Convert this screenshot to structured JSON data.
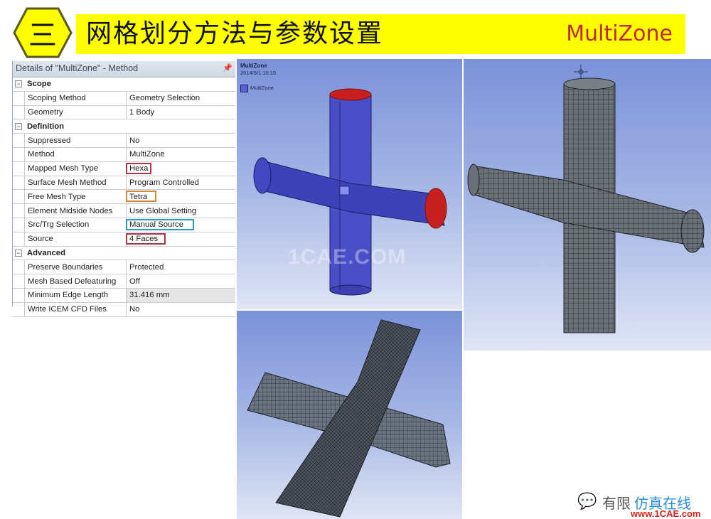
{
  "banner": {
    "section_numeral": "三",
    "title": "网格划分方法与参数设置",
    "tag": "MultiZone",
    "colors": {
      "banner_bg": "#ffff00",
      "tag_text": "#c0281e",
      "hex_fill": "#ffff00",
      "hex_border": "#5a5a1e"
    }
  },
  "details_panel": {
    "title": "Details of \"MultiZone\" - Method",
    "pin_icon": "pin-icon",
    "categories": [
      {
        "label": "Scope",
        "rows": [
          {
            "name": "Scoping Method",
            "value": "Geometry Selection"
          },
          {
            "name": "Geometry",
            "value": "1 Body"
          }
        ]
      },
      {
        "label": "Definition",
        "rows": [
          {
            "name": "Suppressed",
            "value": "No"
          },
          {
            "name": "Method",
            "value": "MultiZone"
          },
          {
            "name": "Mapped Mesh Type",
            "value": "Hexa",
            "highlight": "#b0324a"
          },
          {
            "name": "Surface Mesh Method",
            "value": "Program Controlled"
          },
          {
            "name": "Free Mesh Type",
            "value": "Tetra",
            "highlight": "#d58a3a"
          },
          {
            "name": "Element Midside Nodes",
            "value": "Use Global Setting"
          },
          {
            "name": "Src/Trg Selection",
            "value": "Manual Source",
            "highlight": "#2a9bb8"
          },
          {
            "name": "Source",
            "value": "4 Faces",
            "highlight": "#b0324a"
          }
        ]
      },
      {
        "label": "Advanced",
        "rows": [
          {
            "name": "Preserve Boundaries",
            "value": "Protected"
          },
          {
            "name": "Mesh Based Defeaturing",
            "value": "Off"
          },
          {
            "name": "Minimum Edge Length",
            "value": "31.416 mm",
            "shaded": true
          },
          {
            "name": "Write ICEM CFD Files",
            "value": "No"
          }
        ]
      }
    ]
  },
  "viewport_geometry": {
    "title": "MultiZone",
    "date": "2014/9/1 10:15",
    "legend_label": "MultiZone",
    "watermark": "1CAE.COM",
    "colors": {
      "body": "#4a4fc8",
      "source_face": "#c8201e"
    }
  },
  "viewport_hex_mesh": {
    "colors": {
      "mesh": "#5a6068"
    }
  },
  "viewport_tet_mesh": {
    "colors": {
      "mesh": "#4a5058"
    }
  },
  "footer": {
    "wechat_icon": "wechat-icon",
    "brand_cn_part1": "有限",
    "brand_cn_part2": "仿真在线",
    "url": "www.1CAE.com"
  }
}
